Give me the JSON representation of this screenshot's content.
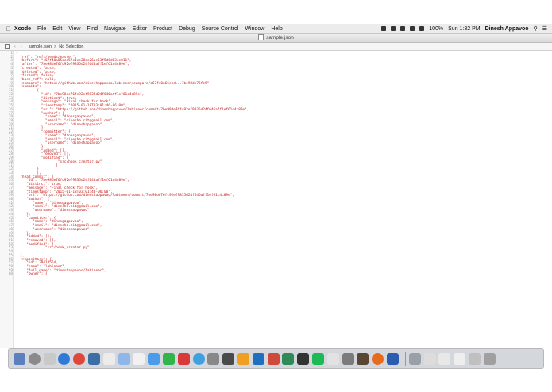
{
  "menubar": {
    "app": "Xcode",
    "items": [
      "File",
      "Edit",
      "View",
      "Find",
      "Navigate",
      "Editor",
      "Product",
      "Debug",
      "Source Control",
      "Window",
      "Help"
    ],
    "battery": "100%",
    "clock": "Sun 1:32 PM",
    "user": "Dinesh Appavoo"
  },
  "window": {
    "title": "sample.json",
    "breadcrumb_file": "sample.json",
    "breadcrumb_sep": ">",
    "breadcrumb_selection": "No Selection"
  },
  "code_lines": [
    "{",
    "  \"ref\": \"refs/heads/master\",",
    "  \"before\": \"c67f40a65ecd5fc1ee28de26ae53f5d6d034e011\",",
    "  \"after\": \"7be98de76fc92ef9835d24f646aff1ef61c4c89e\",",
    "  \"created\": false,",
    "  \"deleted\": false,",
    "  \"forced\": false,",
    "  \"base_ref\": null,",
    "  \"compare\": \"https://github.com/dineshappavoo/labineer/compare/c67f40a65ecd...7be98de76fc9\",",
    "  \"commits\": [",
    "          {",
    "            \"id\": \"7be98de76fc92ef9835d24f646aff1ef61c4c89e\",",
    "            \"distinct\": true,",
    "            \"message\": \"Final check for hook\",",
    "            \"timestamp\": \"2015-01-18T03:01:46-06:00\",",
    "            \"url\": \"https://github.com/dineshappavoo/labineer/commit/7be98de76fc92ef9835d24f646aff1ef61c4c89e\",",
    "            \"author\": {",
    "              \"name\": \"dinesgappavoo\",",
    "              \"email\": \"dinesha.cit@gmail.com\",",
    "              \"username\": \"dineshappavoo\"",
    "            },",
    "            \"committer\": {",
    "              \"name\": \"dinesgappavoo\",",
    "              \"email\": \"dinesha.cit@gmail.com\",",
    "              \"username\": \"dineshappavoo\"",
    "            },",
    "            \"added\": [],",
    "            \"removed\": [],",
    "            \"modified\": [",
    "                    \"src/hook_creator.py\"",
    "                   ]",
    "          }",
    "          ],",
    "  \"head_commit\": {",
    "     \"id\": \"7be98de76fc92ef9835d24f646aff1ef61c4c89e\",",
    "     \"distinct\": true,",
    "     \"message\": \"Final check for hook\",",
    "     \"timestamp\": \"2015-01-18T03:01:46-06:00\",",
    "     \"url\": \"https://github.com/dineshappavoo/labineer/commit/7be98de76fc92ef9835d24f646aff1ef61c4c89e\",",
    "     \"author\": {",
    "        \"name\": \"dinesgappavoo\",",
    "        \"email\": \"dinesha.cit@gmail.com\",",
    "        \"username\": \"dineshappavoo\"",
    "     },",
    "     \"committer\": {",
    "        \"name\": \"dinesgappavoo\",",
    "        \"email\": \"dinesha.cit@gmail.com\",",
    "        \"username\": \"dineshappavoo\"",
    "     },",
    "     \"added\": [],",
    "     \"removed\": [],",
    "     \"modified\": [",
    "              \"src/hook_creator.py\"",
    "             ]",
    "  },",
    "  \"repository\": {",
    "     \"id\": 29414554,",
    "     \"name\": \"labineer\",",
    "     \"full_name\": \"dineshappavoo/labineer\",",
    "     \"owner\": {"
  ],
  "dock": {
    "icon_colors": [
      "#5b7fbf",
      "#8a8a8a",
      "#c9c9c9",
      "#2f7ad6",
      "#e0463a",
      "#3b6ea5",
      "#ececec",
      "#8fb6e8",
      "#f1f1f1",
      "#4c9be8",
      "#31b54a",
      "#d83a3a",
      "#3fa0e0",
      "#888888",
      "#4a4a4a",
      "#f0a020",
      "#1f6fc1",
      "#d04a3c",
      "#2e8b57",
      "#333333",
      "#1db954",
      "#e2e2e2",
      "#7b7b7b",
      "#5a4632",
      "#e86b1d",
      "#2a5db0",
      "#9aa0a8",
      "#dcdcdc",
      "#e8e8e8",
      "#eeeeee",
      "#c0c0c0",
      "#a0a0a0"
    ]
  }
}
